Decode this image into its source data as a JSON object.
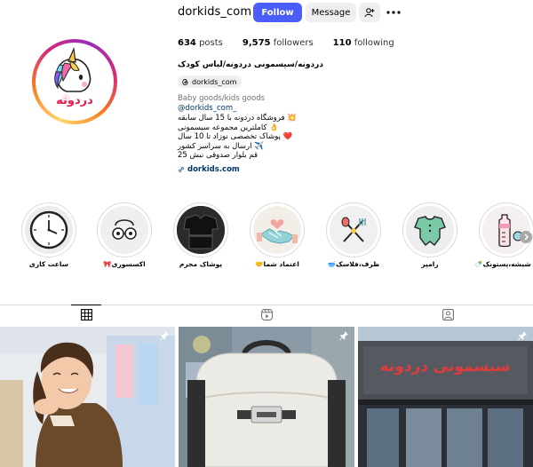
{
  "profile": {
    "username": "dorkids_com",
    "follow_label": "Follow",
    "message_label": "Message",
    "stats": {
      "posts_count": "634",
      "posts_label": "posts",
      "followers_count": "9,575",
      "followers_label": "followers",
      "following_count": "110",
      "following_label": "following"
    },
    "name": "دردونه/سیسمونی دردونه/لباس کودک",
    "threads_handle": "dorkids_com",
    "category": "Baby goods/kids goods",
    "mention": "@dorkids_com_",
    "bio_lines": [
      "💥 فروشگاه دردونه با 15 سال سابقه",
      "👌 کاملترین مجموعه سیسمونی",
      "❤️ پوشاک تخصصی نوزاد تا 10 سال",
      "✈️ ارسال به سراسر کشور",
      "قم بلوار صدوقی نبش 25"
    ],
    "link": "dorkids.com",
    "avatar_text": "دردونه",
    "accent_color": "#4a5df9"
  },
  "highlights": [
    {
      "label": "ساعت کاری",
      "icon": "clock-icon"
    },
    {
      "label": "اکسسوری🎀",
      "icon": "accessory-icon"
    },
    {
      "label": "پوشاک محرم",
      "icon": "clothes-icon"
    },
    {
      "label": "اعتماد شما🤝",
      "icon": "handshake-icon"
    },
    {
      "label": "ظرف،فلاسک🥣",
      "icon": "utensils-icon"
    },
    {
      "label": "رامپر",
      "icon": "romper-icon"
    },
    {
      "label": "شیشه،پستونک🍼",
      "icon": "bottle-icon"
    }
  ],
  "tabs": [
    {
      "name": "posts",
      "icon": "grid-icon",
      "active": true
    },
    {
      "name": "reels",
      "icon": "reels-icon",
      "active": false
    },
    {
      "name": "tagged",
      "icon": "tagged-icon",
      "active": false
    }
  ],
  "posts": [
    {
      "icon": "pin-icon",
      "desc": "girl"
    },
    {
      "icon": "pin-icon",
      "desc": "backpack"
    },
    {
      "icon": "pin-icon",
      "desc": "storefront",
      "sign_text": "سیسمونی دردونه"
    }
  ]
}
